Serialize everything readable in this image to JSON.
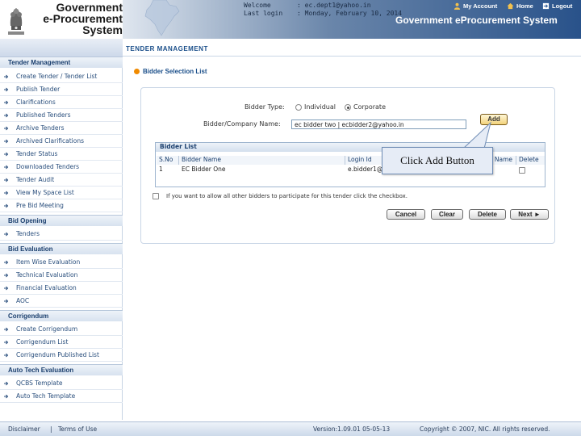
{
  "header": {
    "logo_line1": "Government",
    "logo_line2": "e-Procurement",
    "logo_line3": "System",
    "welcome_label": "Welcome",
    "welcome_value": ": ec.dept1@yahoo.in",
    "last_login_label": "Last login",
    "last_login_value": ": Monday, February 10, 2014",
    "links": [
      "My Account",
      "Home",
      "Logout"
    ],
    "system_title": "Government eProcurement System"
  },
  "page_title": "TENDER MANAGEMENT",
  "sidebar": {
    "sections": [
      {
        "title": "Tender Management",
        "items": [
          "Create Tender / Tender List",
          "Publish Tender",
          "Clarifications",
          "Published Tenders",
          "Archive Tenders",
          "Archived Clarifications",
          "Tender Status",
          "Downloaded Tenders",
          "Tender Audit",
          "View My Space List",
          "Pre Bid Meeting"
        ]
      },
      {
        "title": "Bid Opening",
        "items": [
          "Tenders"
        ]
      },
      {
        "title": "Bid Evaluation",
        "items": [
          "Item Wise Evaluation",
          "Technical Evaluation",
          "Financial Evaluation",
          "AOC"
        ]
      },
      {
        "title": "Corrigendum",
        "items": [
          "Create Corrigendum",
          "Corrigendum List",
          "Corrigendum Published List"
        ]
      },
      {
        "title": "Auto Tech Evaluation",
        "items": [
          "QCBS Template",
          "Auto Tech Template"
        ]
      }
    ]
  },
  "panel": {
    "title": "Bidder Selection List",
    "bidder_type_label": "Bidder Type:",
    "option_individual": "Individual",
    "option_corporate": "Corporate",
    "company_label": "Bidder/Company Name:",
    "company_value": "ec bidder two | ecbidder2@yahoo.in",
    "add_label": "Add",
    "bidder_list_title": "Bidder List",
    "columns": [
      "S.No",
      "Bidder Name",
      "Login Id",
      "Name",
      "Delete"
    ],
    "rows": [
      {
        "sno": "1",
        "name": "EC Bidder One",
        "login": "e.bidder1@"
      }
    ],
    "allow_text": "If you want to allow all other bidders to participate for this tender click the checkbox.",
    "buttons": [
      "Cancel",
      "Clear",
      "Delete",
      "Next ►"
    ],
    "callout": "Click Add Button"
  },
  "footer": {
    "disclaimer": "Disclaimer",
    "terms": "Terms of Use",
    "version": "Version:1.09.01 05-05-13",
    "copyright": "Copyright © 2007, NIC. All rights reserved."
  }
}
